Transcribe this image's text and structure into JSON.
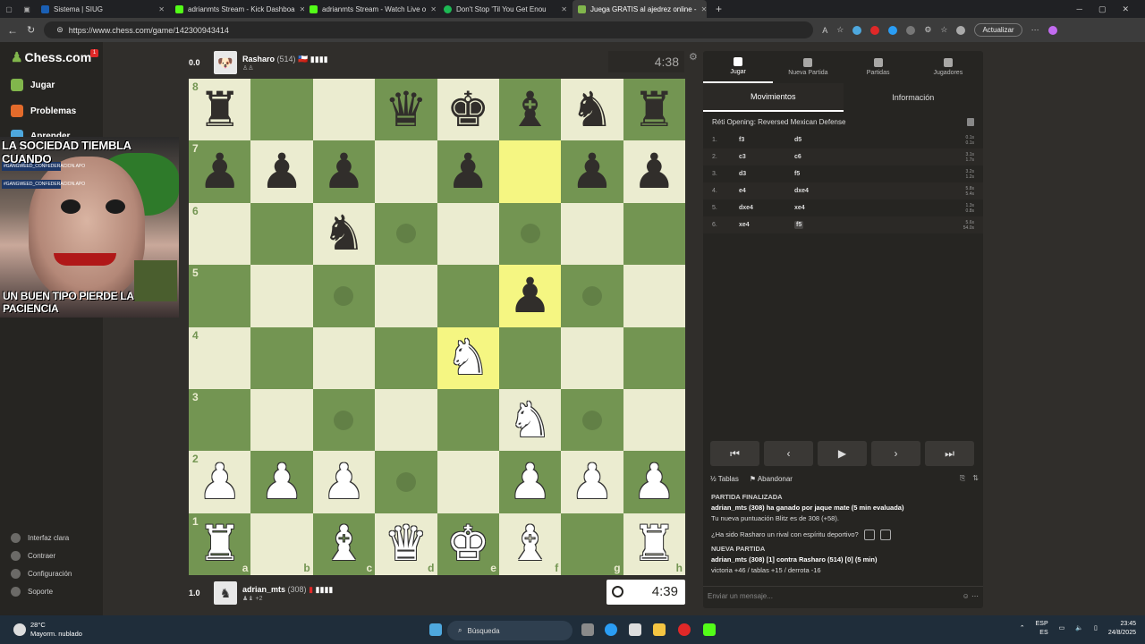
{
  "browser": {
    "tabs": [
      {
        "label": "Sistema | SIUG",
        "color": "#1a5fb4"
      },
      {
        "label": "adrianmts Stream - Kick Dashboa",
        "color": "#53fc18"
      },
      {
        "label": "adrianmts Stream - Watch Live o",
        "color": "#53fc18"
      },
      {
        "label": "Don't Stop 'Til You Get Enou",
        "color": "#1db954"
      },
      {
        "label": "Juega GRATIS al ajedrez online -",
        "color": "#81b64c"
      }
    ],
    "url": "https://www.chess.com/game/142300943414",
    "update_label": "Actualizar"
  },
  "sidebar": {
    "logo": "Chess.com",
    "notif_count": "1",
    "items": [
      {
        "label": "Jugar",
        "color": "#81b64c"
      },
      {
        "label": "Problemas",
        "color": "#e36b2b"
      },
      {
        "label": "Aprender",
        "color": "#4ea8de"
      }
    ],
    "bottom": [
      "Interfaz clara",
      "Contraer",
      "Configuración",
      "Soporte"
    ]
  },
  "meme": {
    "top": "LA SOCIEDAD TIEMBLA CUANDO",
    "bottom": "UN BUEN TIPO PIERDE LA PACIENCIA",
    "sticker1": "#GANGWEED_CONFEDERACION.APO",
    "sticker2": "#GANGWEED_CONFEDERACION.APO"
  },
  "top_player": {
    "score": "0.0",
    "name": "Rasharo",
    "rating": "(514)",
    "flag": "🇨🇱",
    "clock": "4:38"
  },
  "bottom_player": {
    "score": "1.0",
    "name": "adrian_mts",
    "rating": "(308)",
    "sub": "+2",
    "clock": "4:39"
  },
  "board": {
    "ranks": [
      "8",
      "7",
      "6",
      "5",
      "4",
      "3",
      "2",
      "1"
    ],
    "files": [
      "a",
      "b",
      "c",
      "d",
      "e",
      "f",
      "g",
      "h"
    ],
    "position": [
      [
        "br",
        "",
        "",
        "bq",
        "bk",
        "bb",
        "bn",
        "br"
      ],
      [
        "bp",
        "bp",
        "bp",
        "",
        "bp",
        "",
        "bp",
        "bp"
      ],
      [
        "",
        "",
        "bn",
        "",
        "",
        "",
        "",
        ""
      ],
      [
        "",
        "",
        "",
        "",
        "",
        "bp",
        "",
        ""
      ],
      [
        "",
        "",
        "",
        "",
        "wn",
        "",
        "",
        ""
      ],
      [
        "",
        "",
        "",
        "",
        "",
        "wn",
        "",
        ""
      ],
      [
        "wp",
        "wp",
        "wp",
        "",
        "",
        "wp",
        "wp",
        "wp"
      ],
      [
        "wr",
        "",
        "wb",
        "wq",
        "wk",
        "wb",
        "",
        "wr"
      ]
    ],
    "highlights": [
      "f7",
      "f5",
      "e4"
    ],
    "hints": [
      "d6",
      "f6",
      "c5",
      "g5",
      "c3",
      "g3",
      "d2"
    ]
  },
  "panel": {
    "tabs": [
      "Jugar",
      "Nueva Partida",
      "Partidas",
      "Jugadores"
    ],
    "subtabs": [
      "Movimientos",
      "Información"
    ],
    "opening": "Réti Opening: Reversed Mexican Defense",
    "moves": [
      {
        "n": "1.",
        "w": "f3",
        "b": "d5",
        "t1": "0.1s",
        "t2": "0.1s"
      },
      {
        "n": "2.",
        "w": "c3",
        "b": "c6",
        "t1": "3.1s",
        "t2": "1.7s"
      },
      {
        "n": "3.",
        "w": "d3",
        "b": "f5",
        "t1": "3.2s",
        "t2": "1.2s"
      },
      {
        "n": "4.",
        "w": "e4",
        "b": "dxe4",
        "t1": "5.8s",
        "t2": "5.4s"
      },
      {
        "n": "5.",
        "w": "dxe4",
        "b": "xe4",
        "t1": "1.3s",
        "t2": "0.8s"
      },
      {
        "n": "6.",
        "w": "xe4",
        "b": "f5",
        "t1": "5.6s",
        "t2": "54.0s"
      }
    ],
    "draw_label": "Tablas",
    "resign_label": "Abandonar",
    "chat": {
      "h1": "PARTIDA FINALIZADA",
      "l1": "adrian_mts (308) ha ganado por jaque mate (5 min evaluada)",
      "l2": "Tu nueva puntuación Blitz es de 308 (+58).",
      "q": "¿Ha sido Rasharo un rival con espíritu deportivo?",
      "h2": "NUEVA PARTIDA",
      "l3": "adrian_mts (308) [1] contra Rasharo (514) [0] (5 min)",
      "l4": "victoria +46 / tablas +15 / derrota -16"
    },
    "message_placeholder": "Enviar un mensaje..."
  },
  "taskbar": {
    "temp": "28°C",
    "weather": "Mayorm. nublado",
    "search": "Búsqueda",
    "lang1": "ESP",
    "lang2": "ES",
    "time": "23:45",
    "date": "24/8/2025"
  }
}
